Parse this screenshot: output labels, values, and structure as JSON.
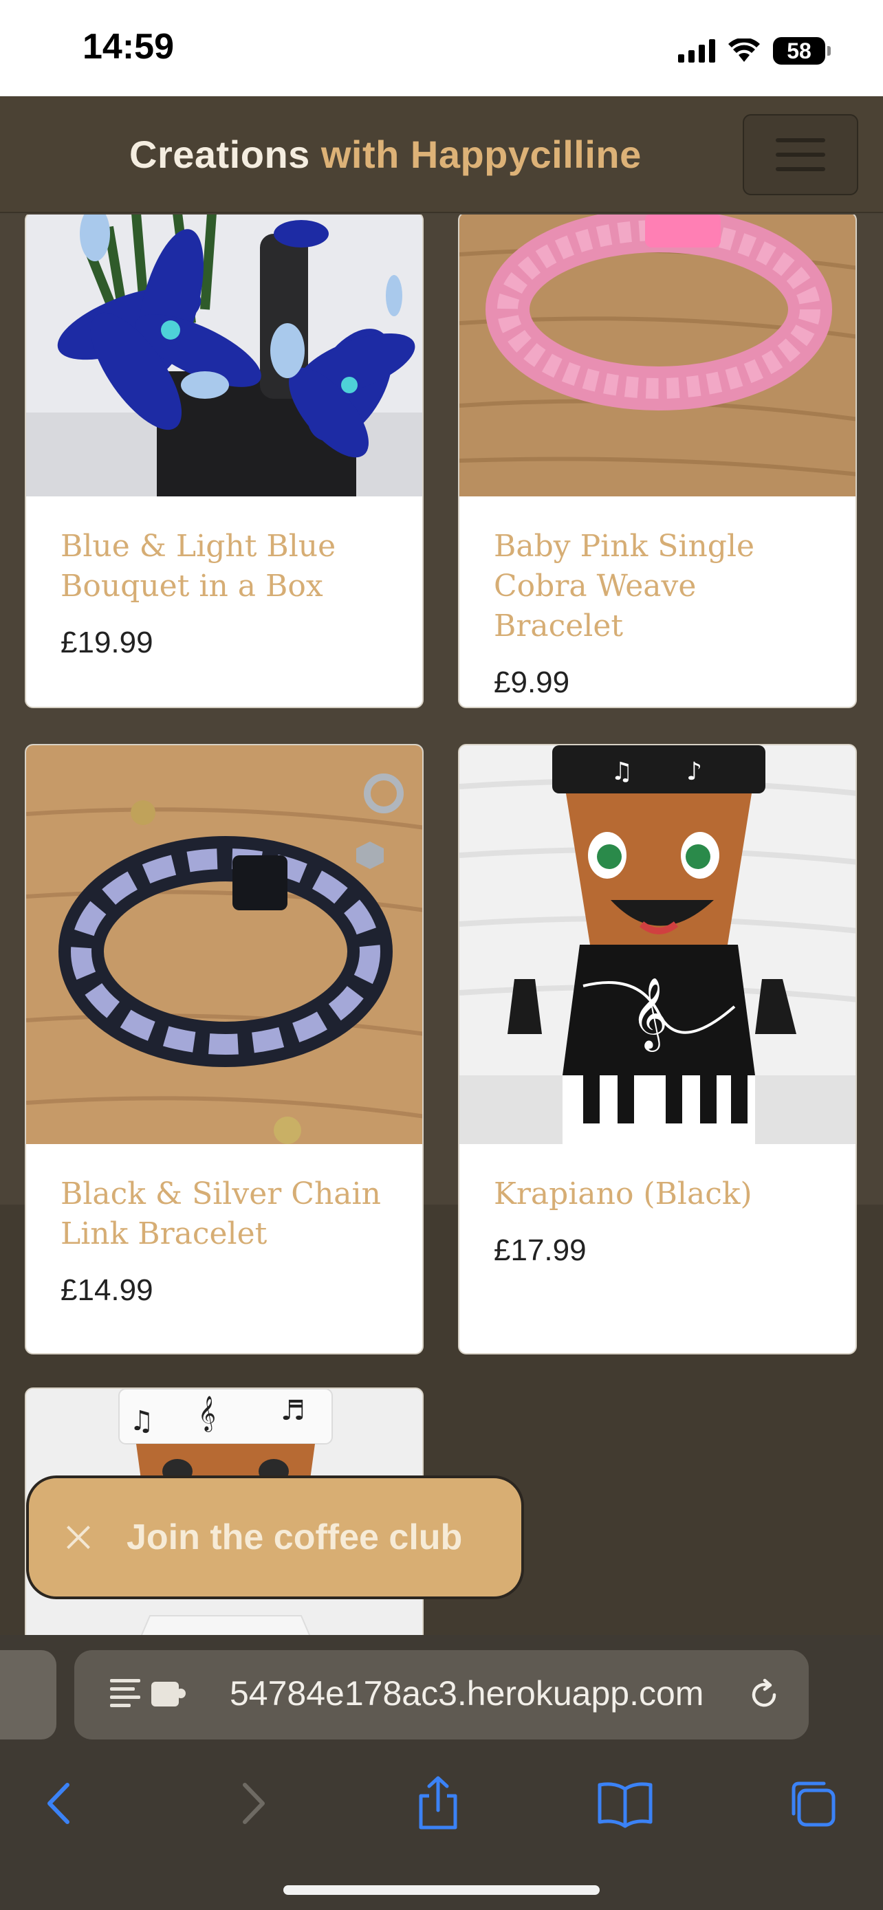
{
  "status_bar": {
    "time": "14:59",
    "battery": "58"
  },
  "navbar": {
    "brand_part1": "Creations",
    "brand_part2": "with Happycilline",
    "menu_icon": "hamburger-menu-icon"
  },
  "products": [
    {
      "title": "Blue & Light Blue Bouquet in a Box",
      "price": "£19.99"
    },
    {
      "title": "Baby Pink Single Cobra Weave Bracelet",
      "price": "£9.99"
    },
    {
      "title": "Black & Silver Chain Link Bracelet",
      "price": "£14.99"
    },
    {
      "title": "Krapiano (Black)",
      "price": "£17.99"
    }
  ],
  "coffee_club": {
    "label": "Join the coffee club"
  },
  "browser": {
    "url": "54784e178ac3.herokuapp.com"
  },
  "colors": {
    "accent": "#ddb277",
    "navbar": "#4b4234",
    "title_gold": "#d6ad74",
    "safari_blue": "#3b82f6"
  }
}
